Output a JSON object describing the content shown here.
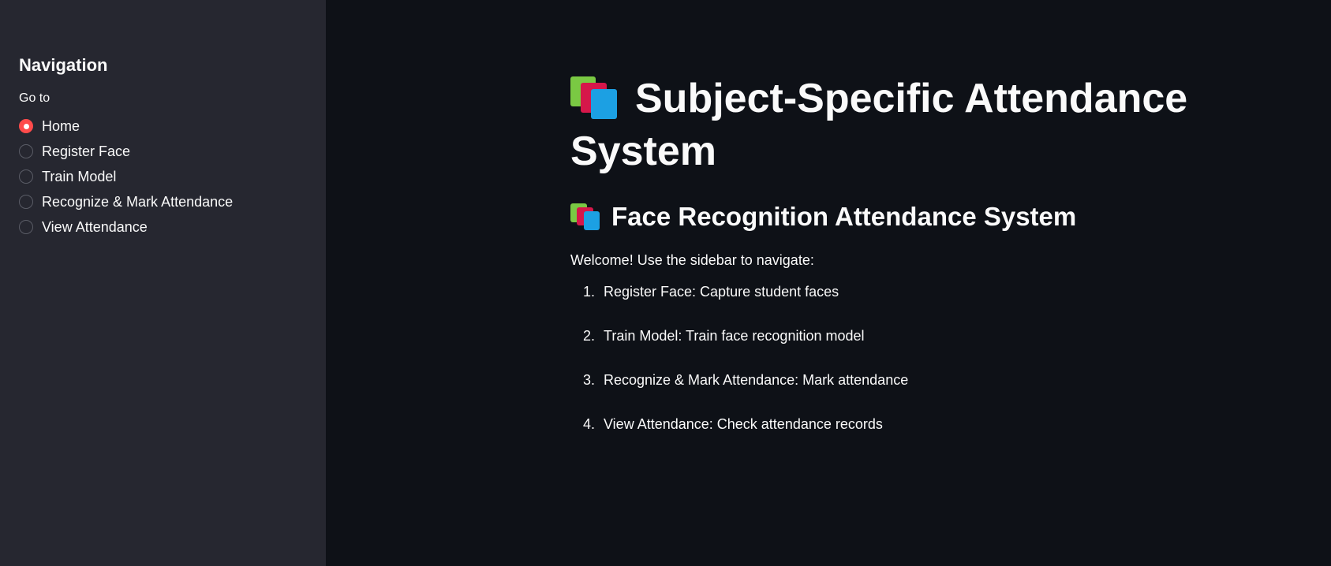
{
  "sidebar": {
    "heading": "Navigation",
    "radio_label": "Go to",
    "options": [
      {
        "label": "Home",
        "selected": true
      },
      {
        "label": "Register Face",
        "selected": false
      },
      {
        "label": "Train Model",
        "selected": false
      },
      {
        "label": "Recognize & Mark Attendance",
        "selected": false
      },
      {
        "label": "View Attendance",
        "selected": false
      }
    ]
  },
  "main": {
    "title": "Subject-Specific Attendance System",
    "title_icon": "books-icon",
    "subtitle": "Face Recognition Attendance System",
    "subtitle_icon": "books-icon",
    "welcome": "Welcome! Use the sidebar to navigate:",
    "steps": [
      "Register Face: Capture student faces",
      "Train Model: Train face recognition model",
      "Recognize & Mark Attendance: Mark attendance",
      "View Attendance: Check attendance records"
    ]
  },
  "colors": {
    "sidebar_bg": "#262730",
    "main_bg": "#0e1117",
    "accent": "#ff4b4b",
    "text": "#fafafa"
  }
}
